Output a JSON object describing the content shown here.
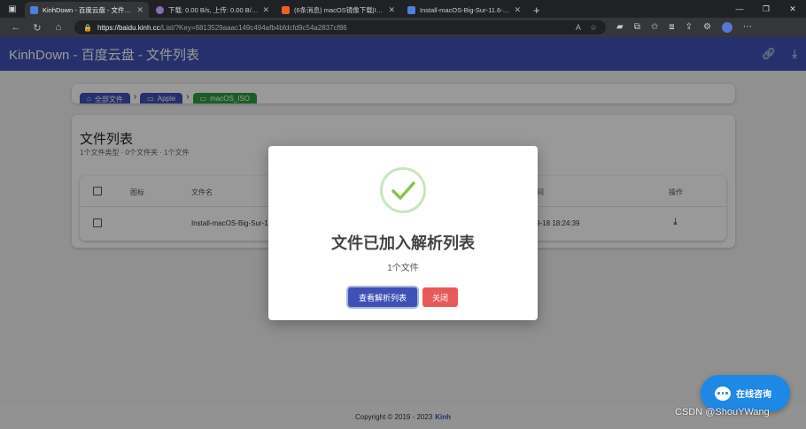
{
  "browser": {
    "tabs": [
      {
        "label": "KinhDown - 百度云盘 - 文件列表",
        "active": true,
        "favicon_color": "#4f7fd8"
      },
      {
        "label": "下载: 0.00 B/s, 上传: 0.00 B/s - Ar",
        "active": false,
        "favicon_color": "#8a6bb8"
      },
      {
        "label": "(6条消息) macOS镜像下载|ISO…",
        "active": false,
        "favicon_color": "#e8612c"
      },
      {
        "label": "Install-macOS-Big-Sur-11.6-20G…",
        "active": false,
        "favicon_color": "#4f7fd8"
      }
    ],
    "url_domain": "https://baidu.kinh.cc",
    "url_rest": "/List/?Key=6813529aaac149c494afb4bfdcfd9c54a2837cf86"
  },
  "app": {
    "title": "KinhDown - 百度云盘 - 文件列表"
  },
  "breadcrumb": {
    "items": [
      "全部文件",
      "Apple",
      "macOS_ISO"
    ]
  },
  "files": {
    "title": "文件列表",
    "subtitle": "1个文件类型 · 0个文件夹 · 1个文件",
    "columns": {
      "icon": "图标",
      "name": "文件名",
      "time": "时间",
      "action": "操作"
    },
    "rows": [
      {
        "name": "Install-macOS-Big-Sur-1",
        "time": "-09-18 18:24:39"
      }
    ]
  },
  "modal": {
    "title": "文件已加入解析列表",
    "text": "1个文件",
    "primary_label": "查看解析列表",
    "close_label": "关闭"
  },
  "footer": {
    "copyright": "Copyright © 2019 - 2023",
    "brand": "Kinh"
  },
  "chat": {
    "label": "在线咨询"
  },
  "watermark": "CSDN @ShouYWang",
  "colors": {
    "primary": "#3f51b5",
    "success": "#8bc34a",
    "danger": "#e85a5a",
    "crumb_active": "#2e9b3e",
    "chat": "#1e88e5"
  }
}
